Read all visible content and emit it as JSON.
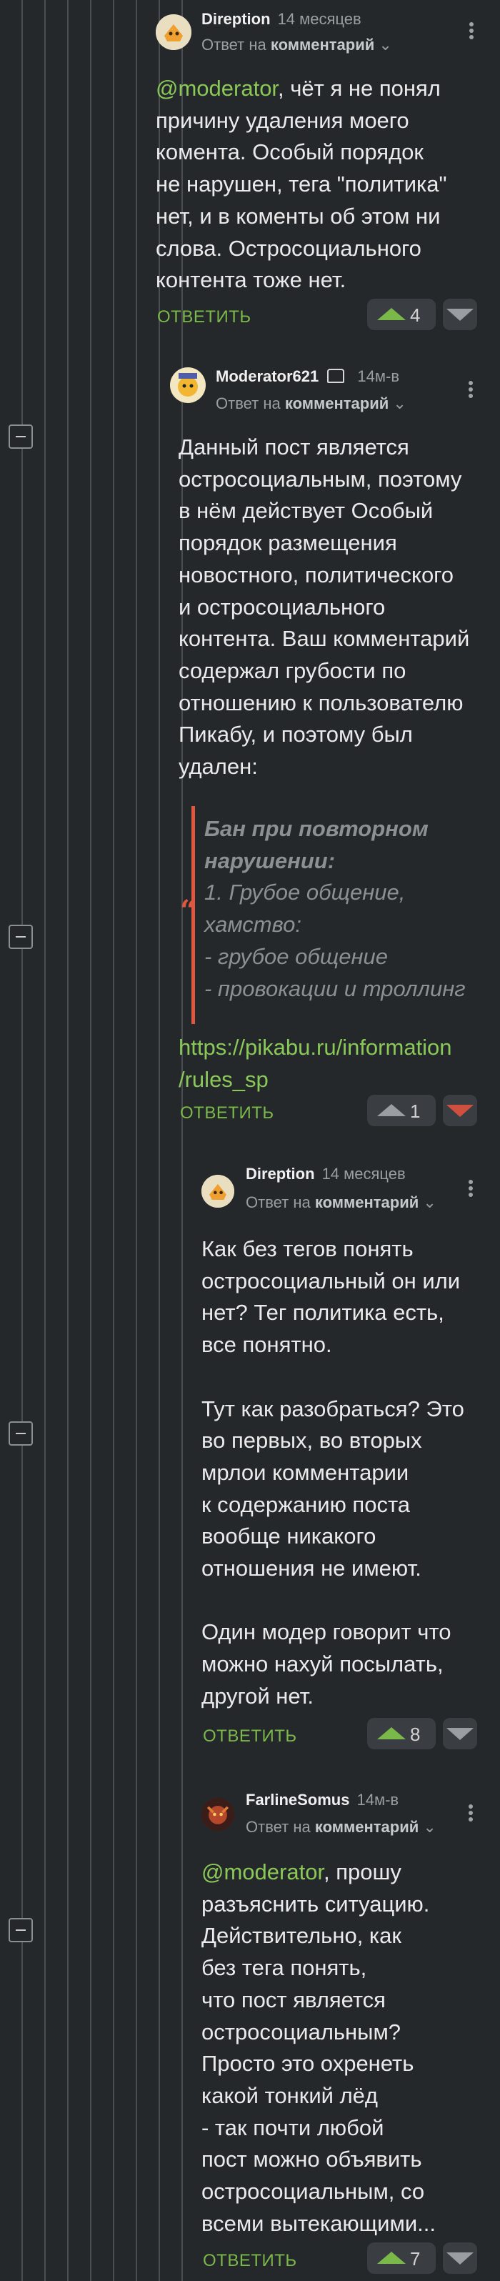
{
  "thread": {
    "reply_label": "ОТВЕТИТЬ",
    "reply_to_prefix": "Ответ на",
    "reply_to_target": "комментарий"
  },
  "comments": [
    {
      "author": "Direption",
      "time": "14 месяцев",
      "mention": "@moderator",
      "text": ", чёт я не понял\nпричину удаления моего\nкомента. Особый порядок\nне нарушен, тега \"политика\"\nнет, и в коменты об этом ни\nслова. Остросоциального\nконтента тоже нет.",
      "votes": "4"
    },
    {
      "author": "Moderator621",
      "time": "14м-в",
      "text": "Данный пост является\nостросоциальным, поэтому\nв нём действует Особый\nпорядок размещения\nновостного, политического\nи остросоциального\nконтента. Ваш комментарий\nсодержал грубости по\nотношению к пользователю\nПикабу, и поэтому был\nудален:",
      "quote_title": "Бан при повторном\nнарушении:",
      "quote_body": " 1. Грубое общение,\nхамство:\n - грубое общение\n - провокации и троллинг",
      "link": "https://pikabu.ru/information\n/rules_sp",
      "votes": "1"
    },
    {
      "author": "Direption",
      "time": "14 месяцев",
      "text": "Как без тегов понять\nостросоциальный он или\nнет? Тег политика есть,\nвсе понятно.\n\nТут как разобраться? Это\nво первых, во вторых\nмрлои комментарии\nк содержанию поста\nвообще никакого\nотношения не имеют.\n\nОдин модер говорит что\nможно нахуй посылать,\nдругой нет.",
      "votes": "8"
    },
    {
      "author": "FarlineSomus",
      "time": "14м-в",
      "mention": "@moderator",
      "text": ", прошу\nразъяснить ситуацию.\nДействительно, как\nбез тега понять,\nчто пост является\nостросоциальным?\nПросто это охренеть\nкакой тонкий лёд\n- так почти любой\nпост можно объявить\nостросоциальным, со\nвсеми вытекающими...",
      "votes": "7"
    }
  ],
  "icons": {
    "collapse": "minus-square-icon",
    "up": "upvote-icon",
    "down": "downvote-icon",
    "more": "kebab-icon",
    "moderator_badge": "moderator-badge-icon"
  },
  "colors": {
    "background": "#25282b",
    "accent_green": "#7ab84a",
    "quote_red": "#e0573f",
    "downvote_red": "#d0503f"
  }
}
